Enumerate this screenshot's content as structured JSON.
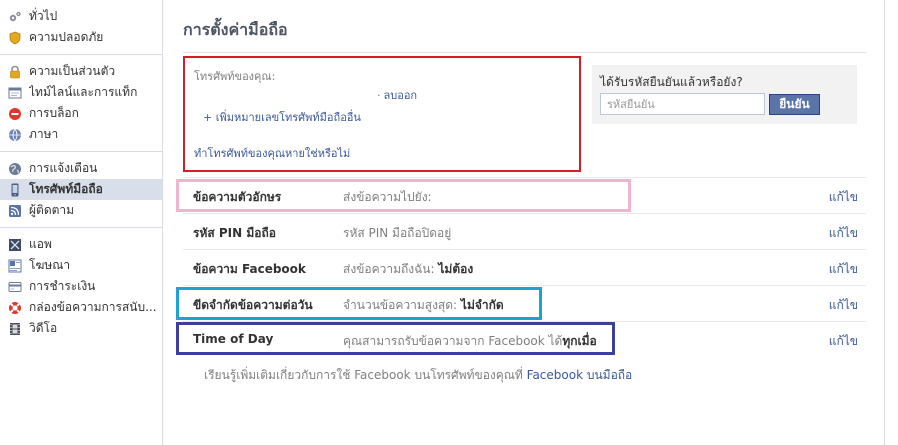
{
  "sidebar": {
    "groups": [
      [
        {
          "label": "ทั่วไป",
          "icon": "gears-icon",
          "active": false
        },
        {
          "label": "ความปลอดภัย",
          "icon": "shield-icon",
          "active": false
        }
      ],
      [
        {
          "label": "ความเป็นส่วนตัว",
          "icon": "lock-icon",
          "active": false
        },
        {
          "label": "ไทม์ไลน์และการแท็ก",
          "icon": "timeline-icon",
          "active": false
        },
        {
          "label": "การบล็อก",
          "icon": "block-icon",
          "active": false
        },
        {
          "label": "ภาษา",
          "icon": "globe-icon",
          "active": false
        }
      ],
      [
        {
          "label": "การแจ้งเตือน",
          "icon": "notification-globe-icon",
          "active": false
        },
        {
          "label": "โทรศัพท์มือถือ",
          "icon": "mobile-phone-icon",
          "active": true
        },
        {
          "label": "ผู้ติดตาม",
          "icon": "rss-icon",
          "active": false
        }
      ],
      [
        {
          "label": "แอพ",
          "icon": "apps-icon",
          "active": false
        },
        {
          "label": "โฆษณา",
          "icon": "ads-icon",
          "active": false
        },
        {
          "label": "การชำระเงิน",
          "icon": "credit-card-icon",
          "active": false
        },
        {
          "label": "กล่องข้อความการสนับ...",
          "icon": "lifebuoy-icon",
          "active": false
        },
        {
          "label": "วิดีโอ",
          "icon": "film-icon",
          "active": false
        }
      ]
    ]
  },
  "main": {
    "title": "การตั้งค่ามือถือ",
    "phone": {
      "label": "โทรศัพท์ของคุณ:",
      "remove": "ลบออก",
      "add": "+ เพิ่มหมายเลขโทรศัพท์มือถืออื่น",
      "lost": "ทำโทรศัพท์ของคุณหายใช่หรือไม่"
    },
    "confirm": {
      "question": "ได้รับรหัสยืนยันแล้วหรือยัง?",
      "placeholder": "รหัสยืนยัน",
      "button": "ยืนยัน"
    },
    "rows": [
      {
        "label": "ข้อความตัวอักษร",
        "value": "ส่งข้อความไปยัง:",
        "value_bold": "",
        "edit": "แก้ไข"
      },
      {
        "label": "รหัส PIN มือถือ",
        "value": "รหัส PIN มือถือปิดอยู่",
        "value_bold": "",
        "edit": "แก้ไข"
      },
      {
        "label": "ข้อความ Facebook",
        "value": "ส่งข้อความถึงฉัน: ",
        "value_bold": "ไม่ต้อง",
        "edit": "แก้ไข"
      },
      {
        "label": "ขีดจำกัดข้อความต่อวัน",
        "value": "จำนวนข้อความสูงสุด: ",
        "value_bold": "ไม่จำกัด",
        "edit": "แก้ไข"
      },
      {
        "label": "Time of Day",
        "value": "คุณสามารถรับข้อความจาก Facebook ได้",
        "value_bold": "ทุกเมื่อ",
        "edit": "แก้ไข"
      }
    ],
    "footer": {
      "text": "เรียนรู้เพิ่มเติมเกี่ยวกับการใช้ Facebook บนโทรศัพท์ของคุณที่ ",
      "link": "Facebook บนมือถือ"
    }
  },
  "annotation_colors": {
    "phone_box": "#d21f27",
    "text_messages": "#f2b3cf",
    "daily_limit": "#1aa3d4",
    "time_of_day": "#3d3f9c"
  }
}
